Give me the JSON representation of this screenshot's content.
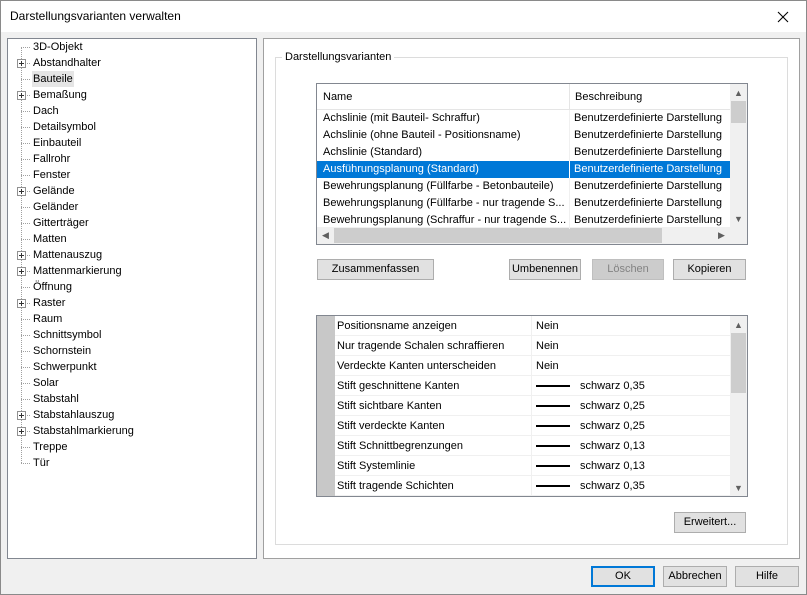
{
  "window": {
    "title": "Darstellungsvarianten verwalten"
  },
  "tree": {
    "items": [
      {
        "label": "3D-Objekt",
        "expandable": false
      },
      {
        "label": "Abstandhalter",
        "expandable": true
      },
      {
        "label": "Bauteile",
        "expandable": false,
        "selected": true
      },
      {
        "label": "Bemaßung",
        "expandable": true
      },
      {
        "label": "Dach",
        "expandable": false
      },
      {
        "label": "Detailsymbol",
        "expandable": false
      },
      {
        "label": "Einbauteil",
        "expandable": false
      },
      {
        "label": "Fallrohr",
        "expandable": false
      },
      {
        "label": "Fenster",
        "expandable": false
      },
      {
        "label": "Gelände",
        "expandable": true
      },
      {
        "label": "Geländer",
        "expandable": false
      },
      {
        "label": "Gitterträger",
        "expandable": false
      },
      {
        "label": "Matten",
        "expandable": false
      },
      {
        "label": "Mattenauszug",
        "expandable": true
      },
      {
        "label": "Mattenmarkierung",
        "expandable": true
      },
      {
        "label": "Öffnung",
        "expandable": false
      },
      {
        "label": "Raster",
        "expandable": true
      },
      {
        "label": "Raum",
        "expandable": false
      },
      {
        "label": "Schnittsymbol",
        "expandable": false
      },
      {
        "label": "Schornstein",
        "expandable": false
      },
      {
        "label": "Schwerpunkt",
        "expandable": false
      },
      {
        "label": "Solar",
        "expandable": false
      },
      {
        "label": "Stabstahl",
        "expandable": false
      },
      {
        "label": "Stabstahlauszug",
        "expandable": true
      },
      {
        "label": "Stabstahlmarkierung",
        "expandable": true
      },
      {
        "label": "Treppe",
        "expandable": false
      },
      {
        "label": "Tür",
        "expandable": false
      }
    ]
  },
  "group": {
    "title": "Darstellungsvarianten"
  },
  "variants": {
    "columns": [
      "Name",
      "Beschreibung"
    ],
    "rows": [
      {
        "name": "Achslinie (mit Bauteil- Schraffur)",
        "desc": "Benutzerdefinierte Darstellung"
      },
      {
        "name": "Achslinie (ohne Bauteil - Positionsname)",
        "desc": "Benutzerdefinierte Darstellung"
      },
      {
        "name": "Achslinie (Standard)",
        "desc": "Benutzerdefinierte Darstellung"
      },
      {
        "name": "Ausführungsplanung (Standard)",
        "desc": "Benutzerdefinierte Darstellung",
        "selected": true
      },
      {
        "name": "Bewehrungsplanung (Füllfarbe - Betonbauteile)",
        "desc": "Benutzerdefinierte Darstellung"
      },
      {
        "name": "Bewehrungsplanung (Füllfarbe - nur tragende S...",
        "desc": "Benutzerdefinierte Darstellung"
      },
      {
        "name": "Bewehrungsplanung (Schraffur - nur tragende S...",
        "desc": "Benutzerdefinierte Darstellung"
      }
    ]
  },
  "buttons": {
    "zusammenfassen": "Zusammenfassen",
    "umbenennen": "Umbenennen",
    "loeschen": "Löschen",
    "kopieren": "Kopieren",
    "erweitert": "Erweitert...",
    "ok": "OK",
    "abbrechen": "Abbrechen",
    "hilfe": "Hilfe"
  },
  "properties": [
    {
      "name": "Positionsname anzeigen",
      "value": "Nein",
      "line": false
    },
    {
      "name": "Nur tragende Schalen schraffieren",
      "value": "Nein",
      "line": false
    },
    {
      "name": "Verdeckte Kanten unterscheiden",
      "value": "Nein",
      "line": false
    },
    {
      "name": "Stift geschnittene Kanten",
      "value": "schwarz 0,35",
      "line": true
    },
    {
      "name": "Stift sichtbare Kanten",
      "value": "schwarz 0,25",
      "line": true
    },
    {
      "name": "Stift verdeckte Kanten",
      "value": "schwarz 0,25",
      "line": true
    },
    {
      "name": "Stift Schnittbegrenzungen",
      "value": "schwarz 0,13",
      "line": true
    },
    {
      "name": "Stift Systemlinie",
      "value": "schwarz 0,13",
      "line": true
    },
    {
      "name": "Stift tragende Schichten",
      "value": "schwarz 0,35",
      "line": true
    }
  ],
  "colors": {
    "selection": "#0078d7",
    "default_button_border": "#0078d7"
  }
}
